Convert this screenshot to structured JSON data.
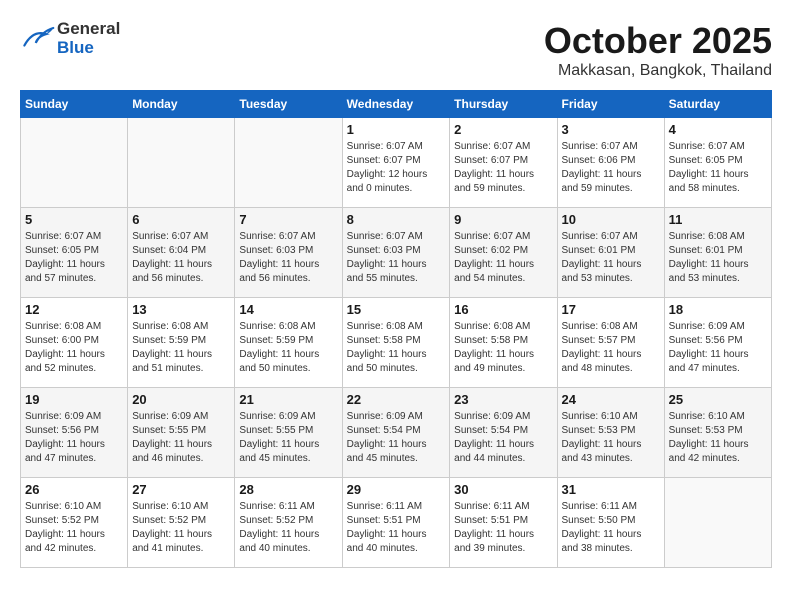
{
  "header": {
    "logo": {
      "general": "General",
      "blue": "Blue"
    },
    "title": "October 2025",
    "location": "Makkasan, Bangkok, Thailand"
  },
  "calendar": {
    "days_of_week": [
      "Sunday",
      "Monday",
      "Tuesday",
      "Wednesday",
      "Thursday",
      "Friday",
      "Saturday"
    ],
    "weeks": [
      [
        {
          "day": "",
          "info": ""
        },
        {
          "day": "",
          "info": ""
        },
        {
          "day": "",
          "info": ""
        },
        {
          "day": "1",
          "sunrise": "Sunrise: 6:07 AM",
          "sunset": "Sunset: 6:07 PM",
          "daylight": "Daylight: 12 hours and 0 minutes."
        },
        {
          "day": "2",
          "sunrise": "Sunrise: 6:07 AM",
          "sunset": "Sunset: 6:07 PM",
          "daylight": "Daylight: 11 hours and 59 minutes."
        },
        {
          "day": "3",
          "sunrise": "Sunrise: 6:07 AM",
          "sunset": "Sunset: 6:06 PM",
          "daylight": "Daylight: 11 hours and 59 minutes."
        },
        {
          "day": "4",
          "sunrise": "Sunrise: 6:07 AM",
          "sunset": "Sunset: 6:05 PM",
          "daylight": "Daylight: 11 hours and 58 minutes."
        }
      ],
      [
        {
          "day": "5",
          "sunrise": "Sunrise: 6:07 AM",
          "sunset": "Sunset: 6:05 PM",
          "daylight": "Daylight: 11 hours and 57 minutes."
        },
        {
          "day": "6",
          "sunrise": "Sunrise: 6:07 AM",
          "sunset": "Sunset: 6:04 PM",
          "daylight": "Daylight: 11 hours and 56 minutes."
        },
        {
          "day": "7",
          "sunrise": "Sunrise: 6:07 AM",
          "sunset": "Sunset: 6:03 PM",
          "daylight": "Daylight: 11 hours and 56 minutes."
        },
        {
          "day": "8",
          "sunrise": "Sunrise: 6:07 AM",
          "sunset": "Sunset: 6:03 PM",
          "daylight": "Daylight: 11 hours and 55 minutes."
        },
        {
          "day": "9",
          "sunrise": "Sunrise: 6:07 AM",
          "sunset": "Sunset: 6:02 PM",
          "daylight": "Daylight: 11 hours and 54 minutes."
        },
        {
          "day": "10",
          "sunrise": "Sunrise: 6:07 AM",
          "sunset": "Sunset: 6:01 PM",
          "daylight": "Daylight: 11 hours and 53 minutes."
        },
        {
          "day": "11",
          "sunrise": "Sunrise: 6:08 AM",
          "sunset": "Sunset: 6:01 PM",
          "daylight": "Daylight: 11 hours and 53 minutes."
        }
      ],
      [
        {
          "day": "12",
          "sunrise": "Sunrise: 6:08 AM",
          "sunset": "Sunset: 6:00 PM",
          "daylight": "Daylight: 11 hours and 52 minutes."
        },
        {
          "day": "13",
          "sunrise": "Sunrise: 6:08 AM",
          "sunset": "Sunset: 5:59 PM",
          "daylight": "Daylight: 11 hours and 51 minutes."
        },
        {
          "day": "14",
          "sunrise": "Sunrise: 6:08 AM",
          "sunset": "Sunset: 5:59 PM",
          "daylight": "Daylight: 11 hours and 50 minutes."
        },
        {
          "day": "15",
          "sunrise": "Sunrise: 6:08 AM",
          "sunset": "Sunset: 5:58 PM",
          "daylight": "Daylight: 11 hours and 50 minutes."
        },
        {
          "day": "16",
          "sunrise": "Sunrise: 6:08 AM",
          "sunset": "Sunset: 5:58 PM",
          "daylight": "Daylight: 11 hours and 49 minutes."
        },
        {
          "day": "17",
          "sunrise": "Sunrise: 6:08 AM",
          "sunset": "Sunset: 5:57 PM",
          "daylight": "Daylight: 11 hours and 48 minutes."
        },
        {
          "day": "18",
          "sunrise": "Sunrise: 6:09 AM",
          "sunset": "Sunset: 5:56 PM",
          "daylight": "Daylight: 11 hours and 47 minutes."
        }
      ],
      [
        {
          "day": "19",
          "sunrise": "Sunrise: 6:09 AM",
          "sunset": "Sunset: 5:56 PM",
          "daylight": "Daylight: 11 hours and 47 minutes."
        },
        {
          "day": "20",
          "sunrise": "Sunrise: 6:09 AM",
          "sunset": "Sunset: 5:55 PM",
          "daylight": "Daylight: 11 hours and 46 minutes."
        },
        {
          "day": "21",
          "sunrise": "Sunrise: 6:09 AM",
          "sunset": "Sunset: 5:55 PM",
          "daylight": "Daylight: 11 hours and 45 minutes."
        },
        {
          "day": "22",
          "sunrise": "Sunrise: 6:09 AM",
          "sunset": "Sunset: 5:54 PM",
          "daylight": "Daylight: 11 hours and 45 minutes."
        },
        {
          "day": "23",
          "sunrise": "Sunrise: 6:09 AM",
          "sunset": "Sunset: 5:54 PM",
          "daylight": "Daylight: 11 hours and 44 minutes."
        },
        {
          "day": "24",
          "sunrise": "Sunrise: 6:10 AM",
          "sunset": "Sunset: 5:53 PM",
          "daylight": "Daylight: 11 hours and 43 minutes."
        },
        {
          "day": "25",
          "sunrise": "Sunrise: 6:10 AM",
          "sunset": "Sunset: 5:53 PM",
          "daylight": "Daylight: 11 hours and 42 minutes."
        }
      ],
      [
        {
          "day": "26",
          "sunrise": "Sunrise: 6:10 AM",
          "sunset": "Sunset: 5:52 PM",
          "daylight": "Daylight: 11 hours and 42 minutes."
        },
        {
          "day": "27",
          "sunrise": "Sunrise: 6:10 AM",
          "sunset": "Sunset: 5:52 PM",
          "daylight": "Daylight: 11 hours and 41 minutes."
        },
        {
          "day": "28",
          "sunrise": "Sunrise: 6:11 AM",
          "sunset": "Sunset: 5:52 PM",
          "daylight": "Daylight: 11 hours and 40 minutes."
        },
        {
          "day": "29",
          "sunrise": "Sunrise: 6:11 AM",
          "sunset": "Sunset: 5:51 PM",
          "daylight": "Daylight: 11 hours and 40 minutes."
        },
        {
          "day": "30",
          "sunrise": "Sunrise: 6:11 AM",
          "sunset": "Sunset: 5:51 PM",
          "daylight": "Daylight: 11 hours and 39 minutes."
        },
        {
          "day": "31",
          "sunrise": "Sunrise: 6:11 AM",
          "sunset": "Sunset: 5:50 PM",
          "daylight": "Daylight: 11 hours and 38 minutes."
        },
        {
          "day": "",
          "info": ""
        }
      ]
    ]
  }
}
